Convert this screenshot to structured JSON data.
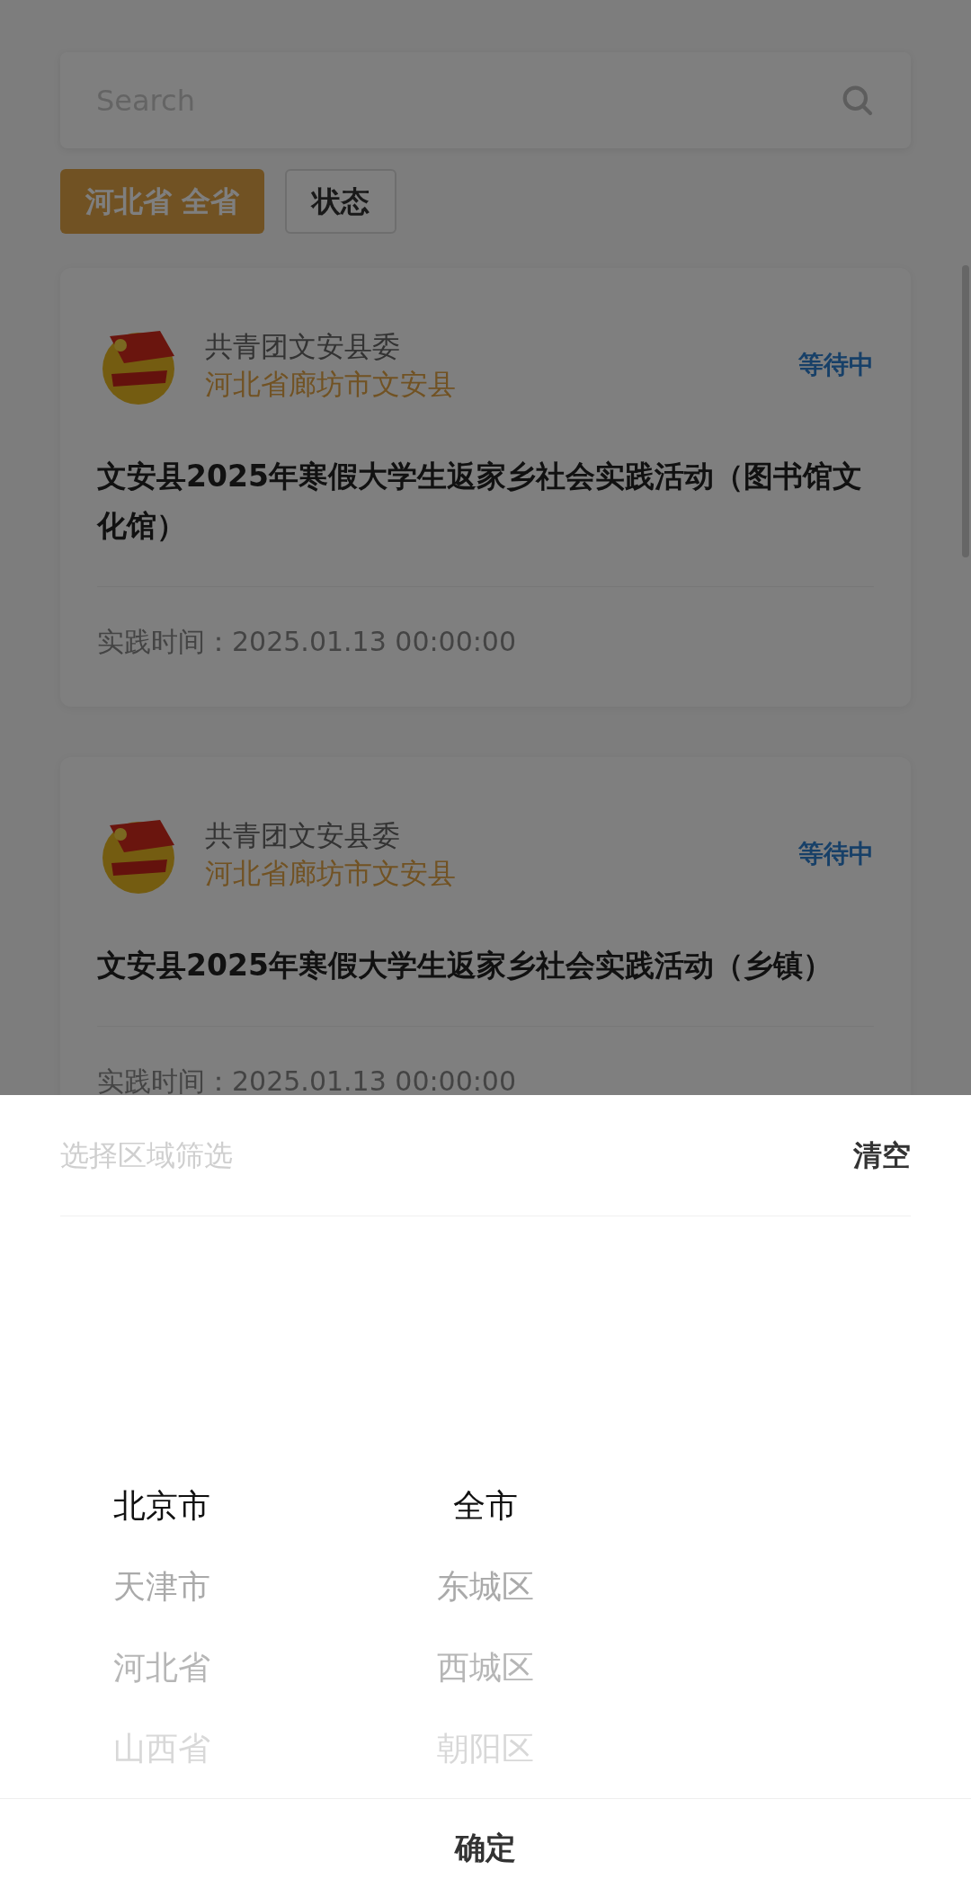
{
  "search": {
    "placeholder": "Search"
  },
  "filters": [
    {
      "label": "河北省 全省",
      "selected": true
    },
    {
      "label": "状态",
      "selected": false
    }
  ],
  "activities": [
    {
      "organizer": "共青团文安县委",
      "region": "河北省廊坊市文安县",
      "status": "等待中",
      "title": "文安县2025年寒假大学生返家乡社会实践活动（图书馆文化馆）",
      "time": "实践时间：2025.01.13 00:00:00"
    },
    {
      "organizer": "共青团文安县委",
      "region": "河北省廊坊市文安县",
      "status": "等待中",
      "title": "文安县2025年寒假大学生返家乡社会实践活动（乡镇）",
      "time": "实践时间：2025.01.13 00:00:00"
    }
  ],
  "region_sheet": {
    "placeholder": "选择区域筛选",
    "clear": "清空",
    "provinces": [
      {
        "label": "北京市",
        "selected": true
      },
      {
        "label": "天津市",
        "selected": false
      },
      {
        "label": "河北省",
        "selected": false
      },
      {
        "label": "山西省",
        "selected": false
      }
    ],
    "cities": [
      {
        "label": "全市",
        "selected": true
      },
      {
        "label": "东城区",
        "selected": false
      },
      {
        "label": "西城区",
        "selected": false
      },
      {
        "label": "朝阳区",
        "selected": false
      }
    ],
    "confirm": "确定"
  }
}
